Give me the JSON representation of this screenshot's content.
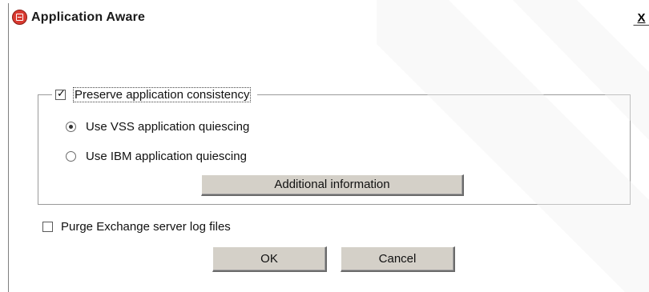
{
  "window": {
    "title": "Application Aware",
    "close_label": "X"
  },
  "group": {
    "legend_checkbox_checked": true,
    "legend_label": "Preserve application consistency",
    "options": [
      {
        "label": "Use VSS application quiescing",
        "selected": true
      },
      {
        "label": "Use IBM application quiescing",
        "selected": false
      }
    ],
    "info_button_label": "Additional information"
  },
  "purge": {
    "checked": false,
    "label": "Purge Exchange server log files"
  },
  "buttons": {
    "ok_label": "OK",
    "cancel_label": "Cancel"
  },
  "colors": {
    "button_face": "#d4d0c8",
    "icon_red": "#d93a31"
  }
}
